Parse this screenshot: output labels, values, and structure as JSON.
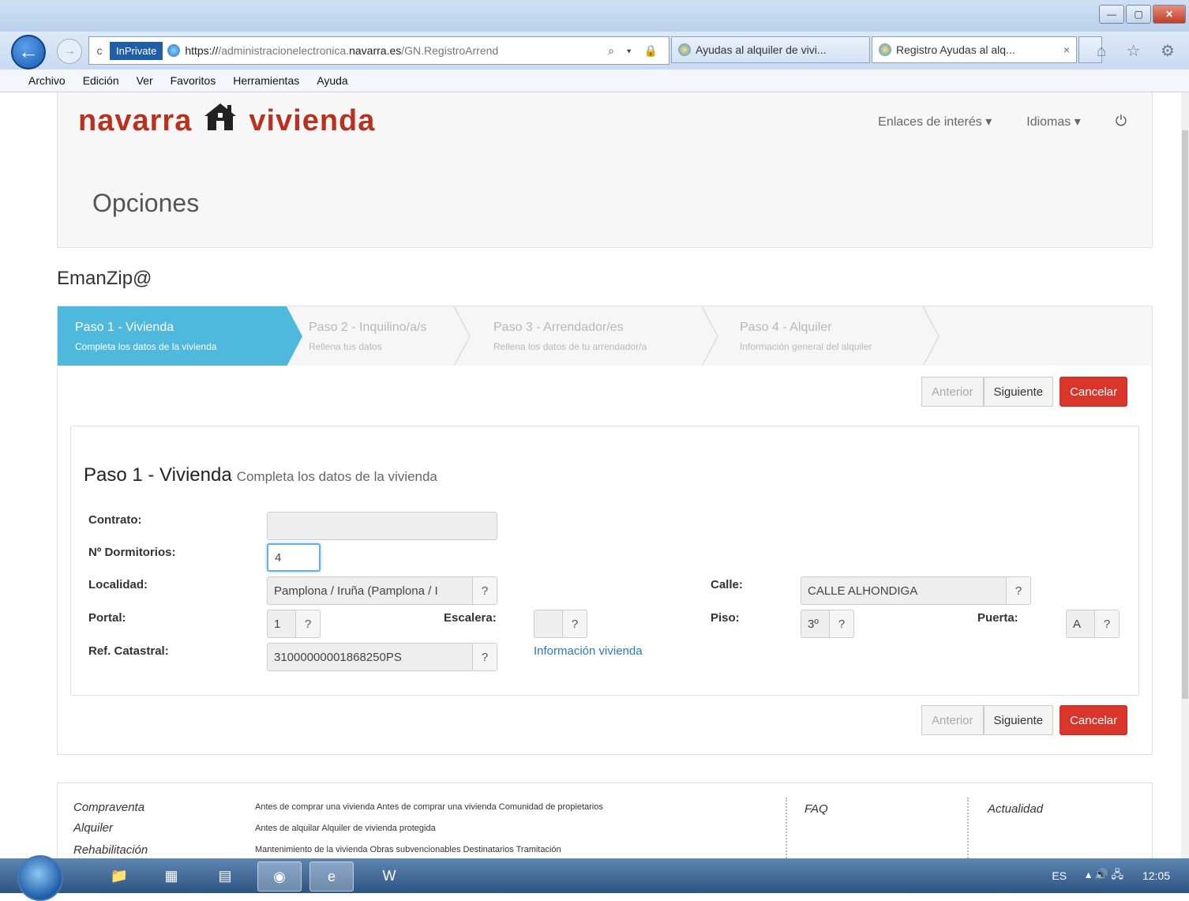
{
  "browser": {
    "window_controls": {
      "minimize": "—",
      "maximize": "▢",
      "close": "✕"
    },
    "back_icon": "←",
    "forward_icon": "→",
    "refresh_icon": "c",
    "inprivate": "InPrivate",
    "url_host": "https://",
    "url_dim": "/administracionelectronica.",
    "url_main": "navarra.es",
    "url_path": "/GN.RegistroArrend",
    "address_icons": "⌕ ▾ 🔒",
    "tabs": [
      {
        "label": "Ayudas al alquiler de vivi..."
      },
      {
        "label": "Registro Ayudas al alq...",
        "close": "×"
      }
    ],
    "nav_icons": "⌂ ☆ ⚙",
    "menu": [
      "Archivo",
      "Edición",
      "Ver",
      "Favoritos",
      "Herramientas",
      "Ayuda"
    ]
  },
  "site": {
    "logo_left": "navarra",
    "logo_right": "vivienda",
    "top_links": {
      "enlaces": "Enlaces de interés ▾",
      "idiomas": "Idiomas ▾",
      "power": "⏻"
    },
    "opciones": "Opciones",
    "app_title": "EmanZip@"
  },
  "wizard": {
    "steps": [
      {
        "title": "Paso 1 - Vivienda",
        "subtitle": "Completa los datos de la vivienda"
      },
      {
        "title": "Paso 2 - Inquilino/a/s",
        "subtitle": "Rellena tus datos"
      },
      {
        "title": "Paso 3 - Arrendador/es",
        "subtitle": "Rellena los datos de tu arrendador/a"
      },
      {
        "title": "Paso 4 - Alquiler",
        "subtitle": "Información general del alquiler"
      }
    ],
    "buttons": {
      "prev": "Anterior",
      "next": "Siguiente",
      "cancel": "Cancelar"
    }
  },
  "form": {
    "title": "Paso 1 - Vivienda",
    "subtitle": "Completa los datos de la vivienda",
    "help": "?",
    "contrato": {
      "label": "Contrato:",
      "value": ""
    },
    "dormitorios": {
      "label": "Nº Dormitorios:",
      "value": "4"
    },
    "localidad": {
      "label": "Localidad:",
      "value": "Pamplona / Iruña (Pamplona / I"
    },
    "calle": {
      "label": "Calle:",
      "value": "CALLE ALHONDIGA"
    },
    "portal": {
      "label": "Portal:",
      "value": "1"
    },
    "escalera": {
      "label": "Escalera:",
      "value": ""
    },
    "piso": {
      "label": "Piso:",
      "value": "3º"
    },
    "puerta": {
      "label": "Puerta:",
      "value": "A"
    },
    "ref_catastral": {
      "label": "Ref. Catastral:",
      "value": "31000000001868250PS"
    },
    "info_link": "Información vivienda"
  },
  "footer": {
    "rows": [
      {
        "category": "Compraventa",
        "desc": "Antes de comprar una vivienda Antes de comprar una vivienda Comunidad de propietarios"
      },
      {
        "category": "Alquiler",
        "desc": "Antes de alquilar Alquiler de vivienda protegida"
      },
      {
        "category": "Rehabilitación",
        "desc": "Mantenimiento de la vivienda Obras subvencionables Destinatarios Tramitación"
      }
    ],
    "faq": "FAQ",
    "actualidad": "Actualidad"
  },
  "taskbar": {
    "lang": "ES",
    "clock": "12:05",
    "tray_icons": "▴ 🔊 🖧",
    "apps": [
      {
        "name": "explorer",
        "icon": "📁"
      },
      {
        "name": "app2",
        "icon": "▦"
      },
      {
        "name": "app3",
        "icon": "▤"
      },
      {
        "name": "app4",
        "icon": "◉"
      },
      {
        "name": "ie",
        "icon": "e"
      },
      {
        "name": "word",
        "icon": "W"
      }
    ]
  },
  "colors": {
    "accent": "#4fb8dd",
    "danger": "#d9352b",
    "logo": "#b8321f"
  }
}
